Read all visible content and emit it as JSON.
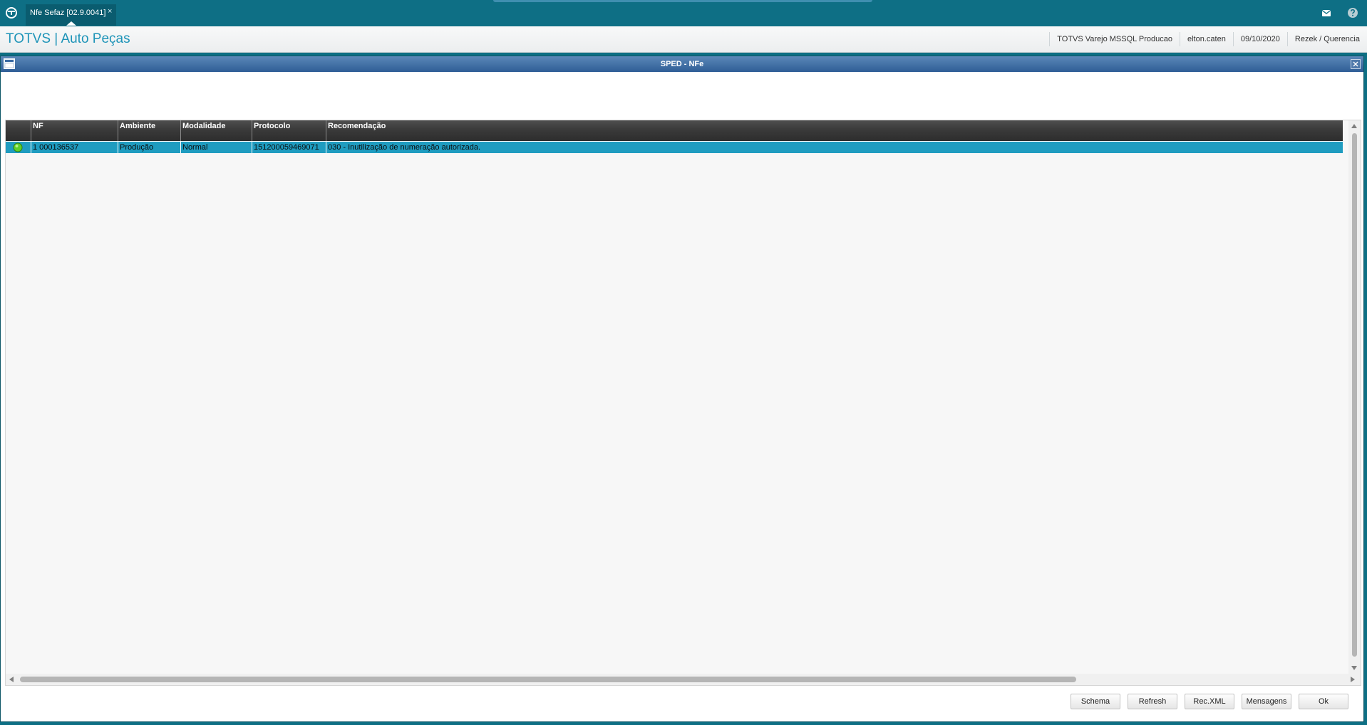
{
  "topbar": {
    "tab_label": "Nfe Sefaz [02.9.0041]",
    "tab_close": "×",
    "icons": [
      "totvs-logo-icon",
      "mail-icon",
      "help-icon"
    ]
  },
  "header": {
    "title": "TOTVS | Auto Peças",
    "environment": "TOTVS Varejo MSSQL Producao",
    "user": "elton.caten",
    "date": "09/10/2020",
    "company": "Rezek / Querencia"
  },
  "dialog": {
    "title": "SPED - NFe"
  },
  "grid": {
    "columns": [
      "",
      "NF",
      "Ambiente",
      "Modalidade",
      "Protocolo",
      "Recomendação"
    ],
    "rows": [
      {
        "status": "green-circle-icon",
        "nf": "1  000136537",
        "ambiente": "Produção",
        "modalidade": "Normal",
        "protocolo": "151200059469071",
        "recomendacao": "030 - Inutilização de numeração autorizada."
      }
    ]
  },
  "buttons": {
    "schema": "Schema",
    "refresh": "Refresh",
    "rec_xml": "Rec.XML",
    "mensagens": "Mensagens",
    "ok": "Ok"
  },
  "colors": {
    "topbar": "#0e6f85",
    "brand_text": "#1e94b8",
    "dialog_title": "#2f5d96",
    "selected_row": "#1f9cc0",
    "status_ok": "#5fcf2a"
  }
}
